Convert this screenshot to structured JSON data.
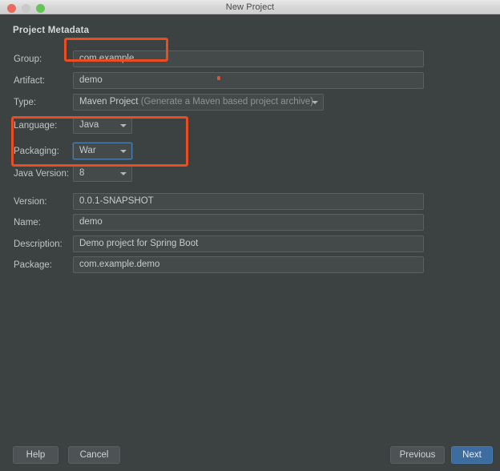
{
  "window": {
    "title": "New Project",
    "controls": {
      "close": "close-button",
      "minimize": "minimize-button",
      "zoom": "zoom-button"
    }
  },
  "section": {
    "title": "Project Metadata"
  },
  "form": {
    "fields": [
      {
        "label": "Group:",
        "value": "com.example",
        "type": "text"
      },
      {
        "label": "Artifact:",
        "value": "demo",
        "type": "text"
      },
      {
        "label": "Type:",
        "value": "Maven Project",
        "hint": "(Generate a Maven based project archive)",
        "type": "combo"
      },
      {
        "label": "Language:",
        "value": "Java",
        "type": "combo"
      },
      {
        "label": "Packaging:",
        "value": "War",
        "type": "combo"
      },
      {
        "label": "Java Version:",
        "value": "8",
        "type": "combo"
      },
      {
        "label": "Version:",
        "value": "0.0.1-SNAPSHOT",
        "type": "text"
      },
      {
        "label": "Name:",
        "value": "demo",
        "type": "text"
      },
      {
        "label": "Description:",
        "value": "Demo project for Spring Boot",
        "type": "text"
      },
      {
        "label": "Package:",
        "value": "com.example.demo",
        "type": "text"
      }
    ]
  },
  "footer": {
    "help": "Help",
    "cancel": "Cancel",
    "previous": "Previous",
    "next": "Next"
  },
  "annotations": {
    "colors": {
      "highlight": "#ea4d22",
      "focus": "#4c7fb1",
      "accent": "#3c6ca0"
    },
    "boxes": [
      {
        "name": "group-field-highlight"
      },
      {
        "name": "language-packaging-highlight"
      }
    ]
  }
}
